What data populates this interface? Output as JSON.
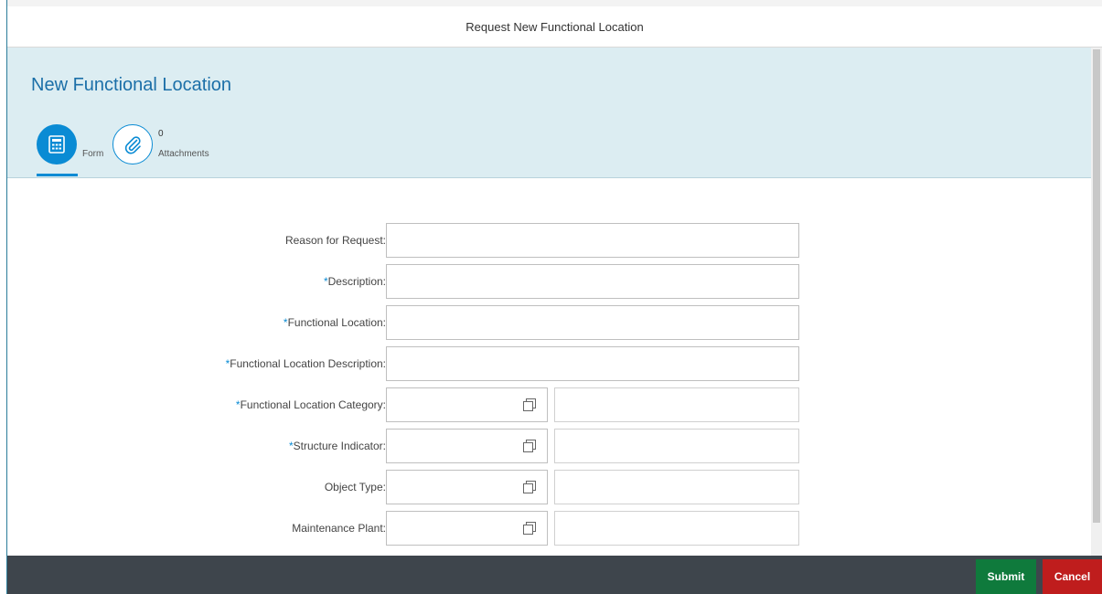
{
  "window": {
    "title": "Request New Functional Location"
  },
  "header": {
    "title": "New Functional Location",
    "tabs": [
      {
        "label": "Form",
        "icon": "form-icon",
        "selected": true
      },
      {
        "label": "Attachments",
        "count": "0",
        "icon": "paperclip-icon",
        "selected": false
      }
    ]
  },
  "form": {
    "fields": [
      {
        "label": "Reason for Request:",
        "required": false,
        "value": ""
      },
      {
        "label": "Description:",
        "required": true,
        "value": ""
      },
      {
        "label": "Functional Location:",
        "required": true,
        "value": ""
      },
      {
        "label": "Functional Location Description:",
        "required": true,
        "value": ""
      },
      {
        "label": "Functional Location Category:",
        "required": true,
        "value": "",
        "description": ""
      },
      {
        "label": "Structure Indicator:",
        "required": true,
        "value": "",
        "description": ""
      },
      {
        "label": "Object Type:",
        "required": false,
        "value": "",
        "description": ""
      },
      {
        "label": "Maintenance Plant:",
        "required": false,
        "value": "",
        "description": ""
      }
    ],
    "required_marker": "*"
  },
  "footer": {
    "submit_label": "Submit",
    "cancel_label": "Cancel"
  },
  "colors": {
    "accent": "#0a8bd4",
    "header_bg": "#dcedf2",
    "footer_bg": "#3e454c",
    "submit": "#0f7a3c",
    "cancel": "#bf1d1d"
  }
}
